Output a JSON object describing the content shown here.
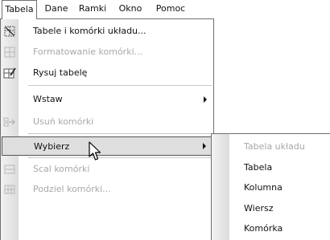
{
  "menubar": {
    "items": [
      {
        "label": "Tabela"
      },
      {
        "label": "Dane"
      },
      {
        "label": "Ramki"
      },
      {
        "label": "Okno"
      },
      {
        "label": "Pomoc"
      }
    ]
  },
  "menu": {
    "items": [
      {
        "label": "Tabele i komórki układu...",
        "icon": "layout-table-cells-icon",
        "enabled": true
      },
      {
        "label": "Formatowanie komórki...",
        "icon": "format-cell-icon",
        "enabled": false
      },
      {
        "label": "Rysuj tabelę",
        "icon": "draw-table-icon",
        "enabled": true
      },
      {
        "label": "Wstaw",
        "enabled": true,
        "submenu": true
      },
      {
        "label": "Usuń komórki",
        "icon": "delete-cells-icon",
        "enabled": false
      },
      {
        "label": "Wybierz",
        "enabled": true,
        "submenu": true,
        "highlighted": true
      },
      {
        "label": "Scal komórki",
        "icon": "merge-cells-icon",
        "enabled": false
      },
      {
        "label": "Podziel komórki...",
        "icon": "split-cells-icon",
        "enabled": false
      }
    ]
  },
  "submenu": {
    "items": [
      {
        "label": "Tabela układu",
        "enabled": false
      },
      {
        "label": "Tabela",
        "enabled": true
      },
      {
        "label": "Kolumna",
        "enabled": true
      },
      {
        "label": "Wiersz",
        "enabled": true
      },
      {
        "label": "Komórka",
        "enabled": true
      }
    ]
  },
  "colors": {
    "highlight_bg": "#dedede",
    "disabled_text": "#a8a8a8",
    "border": "#6f6f6f"
  }
}
